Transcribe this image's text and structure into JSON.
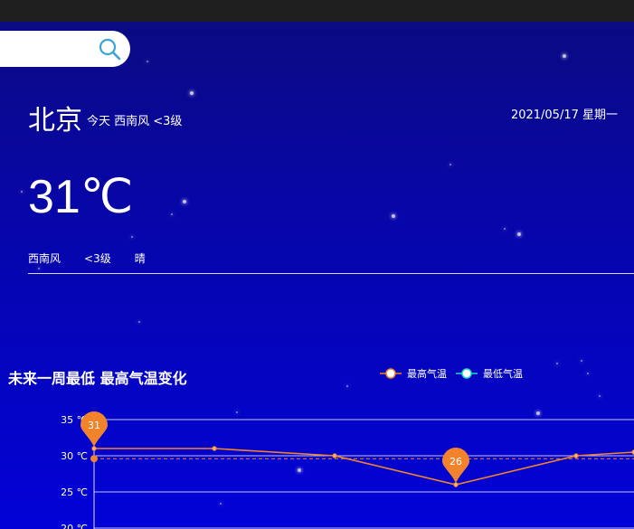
{
  "search": {
    "placeholder": ""
  },
  "header": {
    "city": "北京",
    "today": "今天 西南风 <3级",
    "date": "2021/05/17 星期一"
  },
  "current": {
    "temperature": "31℃",
    "wind_direction": "西南风",
    "wind_level": "<3级",
    "condition": "晴"
  },
  "chart": {
    "title": "未来一周最低 最高气温变化",
    "legend": {
      "high": "最高气温",
      "low": "最低气温"
    },
    "colors": {
      "high": "#f0832c",
      "low": "#25d8c0"
    }
  },
  "chart_data": {
    "type": "line",
    "title": "未来一周最低 最高气温变化",
    "y_ticks": [
      "35 ℃",
      "30 ℃",
      "25 ℃",
      "20 ℃"
    ],
    "ylim": [
      20,
      35
    ],
    "series": [
      {
        "name": "最高气温",
        "values": [
          31,
          31,
          30,
          26,
          30,
          30.5
        ]
      }
    ],
    "max_label": "31",
    "min_label": "26",
    "average_line": 29.6,
    "grid": true
  }
}
